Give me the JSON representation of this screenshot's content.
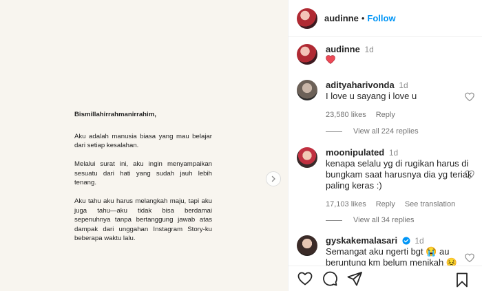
{
  "post": {
    "letter": {
      "greeting": "Bismillahirrahmanirrahim,",
      "paragraphs": [
        "Aku adalah manusia biasa yang mau belajar dari setiap kesalahan.",
        "Melalui surat ini, aku ingin menyampaikan sesuatu dari hati yang sudah jauh lebih tenang.",
        "Aku tahu aku harus melangkah maju, tapi aku juga tahu—aku tidak bisa berdamai sepenuhnya tanpa bertanggung jawab atas dampak dari unggahan Instagram Story-ku beberapa waktu lalu."
      ]
    }
  },
  "header": {
    "username": "audinne",
    "separator": "•",
    "follow_label": "Follow"
  },
  "caption": {
    "username": "audinne",
    "time": "1d",
    "emoji": "❤️"
  },
  "comments": [
    {
      "username": "adityaharivonda",
      "time": "1d",
      "text": "I love u sayang i love u",
      "likes": "23,580 likes",
      "reply": "Reply",
      "view_replies": "View all 224 replies"
    },
    {
      "username": "moonipulated",
      "time": "1d",
      "text": "kenapa selalu yg di rugikan harus di bungkam saat harusnya dia yg teriak paling keras :)",
      "likes": "17,103 likes",
      "reply": "Reply",
      "translation": "See translation",
      "view_replies": "View all 34 replies"
    },
    {
      "username": "gyskakemalasari",
      "time": "1d",
      "text": "Semangat aku ngerti bgt 😭 au beruntung km belum menikah 😣",
      "verified": true
    }
  ],
  "colors": {
    "accent": "#0095f6",
    "heart": "#ed4956",
    "verified": "#0095f6",
    "post_background": "#f8f5ef"
  }
}
